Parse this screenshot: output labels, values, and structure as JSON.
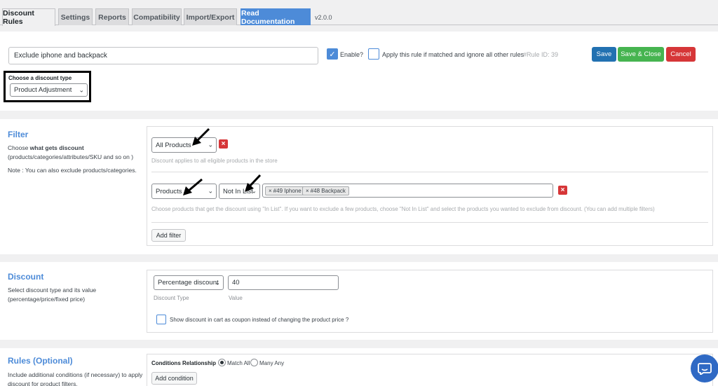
{
  "tabs": {
    "discount_rules": "Discount Rules",
    "settings": "Settings",
    "reports": "Reports",
    "compatibility": "Compatibility",
    "import_export": "Import/Export",
    "read_documentation": "Read Documentation",
    "version": "v2.0.0"
  },
  "rule": {
    "title_value": "Exclude iphone and backpack",
    "enable_label": "Enable?",
    "apply_only_label": "Apply this rule if matched and ignore all other rules",
    "rule_id": "#Rule ID: 39",
    "save_label": "Save",
    "save_close_label": "Save & Close",
    "cancel_label": "Cancel",
    "discount_type_label": "Choose a discount type",
    "discount_type_value": "Product Adjustment"
  },
  "filter": {
    "title": "Filter",
    "desc_prefix": "Choose ",
    "desc_bold": "what gets discount",
    "desc_rest": "(products/categories/attributes/SKU and so on )",
    "note": "Note : You can also exclude products/categories.",
    "row1_select": "All Products",
    "row1_hint": "Discount applies to all eligible products in the store",
    "row2_select": "Products",
    "row2_condition": "Not In List",
    "tags": [
      "#49 Iphone",
      "#48 Backpack"
    ],
    "row2_hint": "Choose products that get the discount using \"In List\". If you want to exclude a few products, choose \"Not In List\" and select the products you wanted to exclude from discount. (You can add multiple filters)",
    "add_filter_label": "Add filter"
  },
  "discount": {
    "title": "Discount",
    "desc_line1": "Select discount type and its value",
    "desc_line2": "(percentage/price/fixed price)",
    "type_value": "Percentage discount",
    "value": "40",
    "type_caption": "Discount Type",
    "value_caption": "Value",
    "coupon_label": "Show discount in cart as coupon instead of changing the product price ?"
  },
  "rules": {
    "title": "Rules (Optional)",
    "desc_line1": "Include additional conditions (if necessary) to apply",
    "desc_line2": "discount for product filters.",
    "relationship_label": "Conditions Relationship",
    "match_all": "Match All",
    "many_any": "Many Any",
    "add_condition_label": "Add condition"
  },
  "colors": {
    "accent": "#4d8bd8",
    "save": "#2271b1",
    "save_close": "#46b450",
    "cancel": "#d63638"
  },
  "icons": [
    "chevron-down-icon",
    "close-icon",
    "checkmark-icon",
    "arrow-pointer-icon",
    "chat-icon"
  ]
}
